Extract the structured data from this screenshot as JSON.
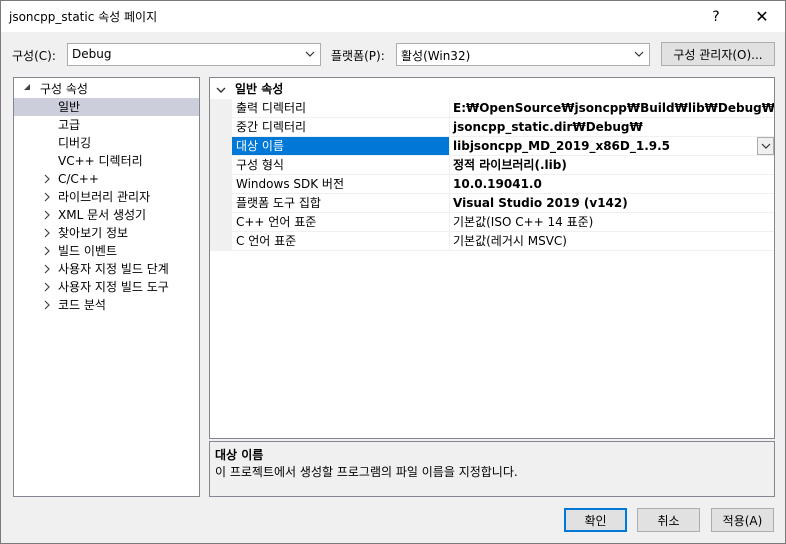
{
  "window": {
    "title": "jsoncpp_static 속성 페이지",
    "help_glyph": "?",
    "close_glyph": "✕"
  },
  "toolbar": {
    "config_label": "구성(C):",
    "config_value": "Debug",
    "platform_label": "플랫폼(P):",
    "platform_value": "활성(Win32)",
    "config_manager_label": "구성 관리자(O)..."
  },
  "tree": {
    "root": "구성 속성",
    "items": [
      {
        "label": "일반",
        "selected": true,
        "expandable": false
      },
      {
        "label": "고급",
        "selected": false,
        "expandable": false
      },
      {
        "label": "디버깅",
        "selected": false,
        "expandable": false
      },
      {
        "label": "VC++ 디렉터리",
        "selected": false,
        "expandable": false
      },
      {
        "label": "C/C++",
        "selected": false,
        "expandable": true
      },
      {
        "label": "라이브러리 관리자",
        "selected": false,
        "expandable": true
      },
      {
        "label": "XML 문서 생성기",
        "selected": false,
        "expandable": true
      },
      {
        "label": "찾아보기 정보",
        "selected": false,
        "expandable": true
      },
      {
        "label": "빌드 이벤트",
        "selected": false,
        "expandable": true
      },
      {
        "label": "사용자 지정 빌드 단계",
        "selected": false,
        "expandable": true
      },
      {
        "label": "사용자 지정 빌드 도구",
        "selected": false,
        "expandable": true
      },
      {
        "label": "코드 분석",
        "selected": false,
        "expandable": true
      }
    ]
  },
  "grid": {
    "category": "일반 속성",
    "rows": [
      {
        "name": "출력 디렉터리",
        "value": "E:₩OpenSource₩jsoncpp₩Build₩lib₩Debug₩",
        "bold": true
      },
      {
        "name": "중간 디렉터리",
        "value": "jsoncpp_static.dir₩Debug₩",
        "bold": true
      },
      {
        "name": "대상 이름",
        "value": "libjsoncpp_MD_2019_x86D_1.9.5",
        "bold": true,
        "selected": true
      },
      {
        "name": "구성 형식",
        "value": "정적 라이브러리(.lib)",
        "bold": true
      },
      {
        "name": "Windows SDK 버전",
        "value": "10.0.19041.0",
        "bold": true
      },
      {
        "name": "플랫폼 도구 집합",
        "value": "Visual Studio 2019 (v142)",
        "bold": true
      },
      {
        "name": "C++ 언어 표준",
        "value": "기본값(ISO C++ 14 표준)",
        "bold": false
      },
      {
        "name": "C 언어 표준",
        "value": "기본값(레거시 MSVC)",
        "bold": false
      }
    ]
  },
  "description": {
    "title": "대상 이름",
    "text": "이 프로젝트에서 생성할 프로그램의 파일 이름을 지정합니다."
  },
  "buttons": {
    "ok": "확인",
    "cancel": "취소",
    "apply": "적용(A)"
  },
  "colors": {
    "selection": "#0078d7",
    "tree_selection": "#cccedb"
  }
}
